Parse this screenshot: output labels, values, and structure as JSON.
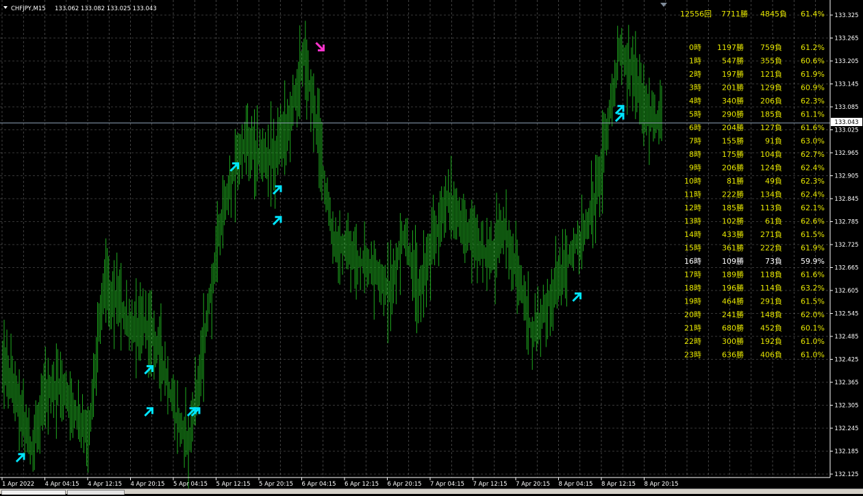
{
  "window": {
    "symbol_title": "CHFJPY,M15",
    "ohlc": "133.062 133.082 133.025 133.043"
  },
  "price_axis": {
    "labels": [
      "133.325",
      "133.265",
      "133.205",
      "133.145",
      "133.085",
      "133.025",
      "132.965",
      "132.905",
      "132.845",
      "132.785",
      "132.725",
      "132.665",
      "132.605",
      "132.545",
      "132.485",
      "132.425",
      "132.365",
      "132.305",
      "132.245",
      "132.185",
      "132.125"
    ],
    "current_price": "133.043"
  },
  "time_axis": {
    "labels": [
      "1 Apr 2022",
      "4 Apr 04:15",
      "4 Apr 12:15",
      "4 Apr 20:15",
      "5 Apr 04:15",
      "5 Apr 12:15",
      "5 Apr 20:15",
      "6 Apr 04:15",
      "6 Apr 12:15",
      "6 Apr 20:15",
      "7 Apr 04:15",
      "7 Apr 12:15",
      "7 Apr 20:15",
      "8 Apr 04:15",
      "8 Apr 12:15",
      "8 Apr 20:15"
    ]
  },
  "stats": {
    "total": {
      "count": "12556回",
      "wins": "7711勝",
      "losses": "4845負",
      "rate": "61.4%"
    },
    "hours": [
      {
        "hour": "0時",
        "wins": "1197勝",
        "losses": "759負",
        "rate": "61.2%"
      },
      {
        "hour": "1時",
        "wins": "547勝",
        "losses": "355負",
        "rate": "60.6%"
      },
      {
        "hour": "2時",
        "wins": "197勝",
        "losses": "121負",
        "rate": "61.9%"
      },
      {
        "hour": "3時",
        "wins": "201勝",
        "losses": "129負",
        "rate": "60.9%"
      },
      {
        "hour": "4時",
        "wins": "340勝",
        "losses": "206負",
        "rate": "62.3%"
      },
      {
        "hour": "5時",
        "wins": "290勝",
        "losses": "185負",
        "rate": "61.1%"
      },
      {
        "hour": "6時",
        "wins": "204勝",
        "losses": "127負",
        "rate": "61.6%"
      },
      {
        "hour": "7時",
        "wins": "155勝",
        "losses": "91負",
        "rate": "63.0%"
      },
      {
        "hour": "8時",
        "wins": "175勝",
        "losses": "104負",
        "rate": "62.7%"
      },
      {
        "hour": "9時",
        "wins": "206勝",
        "losses": "124負",
        "rate": "62.4%"
      },
      {
        "hour": "10時",
        "wins": "81勝",
        "losses": "49負",
        "rate": "62.3%"
      },
      {
        "hour": "11時",
        "wins": "222勝",
        "losses": "134負",
        "rate": "62.4%"
      },
      {
        "hour": "12時",
        "wins": "185勝",
        "losses": "113負",
        "rate": "62.1%"
      },
      {
        "hour": "13時",
        "wins": "102勝",
        "losses": "61負",
        "rate": "62.6%"
      },
      {
        "hour": "14時",
        "wins": "433勝",
        "losses": "271負",
        "rate": "61.5%"
      },
      {
        "hour": "15時",
        "wins": "361勝",
        "losses": "222負",
        "rate": "61.9%"
      },
      {
        "hour": "16時",
        "wins": "109勝",
        "losses": "73負",
        "rate": "59.9%"
      },
      {
        "hour": "17時",
        "wins": "189勝",
        "losses": "118負",
        "rate": "61.6%"
      },
      {
        "hour": "18時",
        "wins": "196勝",
        "losses": "114負",
        "rate": "63.2%"
      },
      {
        "hour": "19時",
        "wins": "464勝",
        "losses": "291負",
        "rate": "61.5%"
      },
      {
        "hour": "20時",
        "wins": "241勝",
        "losses": "148負",
        "rate": "62.0%"
      },
      {
        "hour": "21時",
        "wins": "680勝",
        "losses": "452負",
        "rate": "60.1%"
      },
      {
        "hour": "22時",
        "wins": "300勝",
        "losses": "192負",
        "rate": "61.0%"
      },
      {
        "hour": "23時",
        "wins": "636勝",
        "losses": "406負",
        "rate": "61.0%"
      }
    ],
    "highlight_hour_index": 16
  },
  "colors": {
    "background": "#000000",
    "grid": "#c8c8c8",
    "bars": "#1fae1f",
    "stats_text": "#e6e600",
    "stats_highlight": "#ffffff",
    "buy_arrow": "#00e5ff",
    "sell_arrow": "#ff33cc",
    "axis_text": "#ffffff",
    "price_line": "#8ca0b4"
  },
  "chart_data": {
    "type": "ohlc",
    "symbol": "CHFJPY",
    "timeframe": "M15",
    "ylim": [
      132.125,
      133.335
    ],
    "close_path": [
      {
        "x": "1 Apr 2022",
        "y": 132.42
      },
      {
        "x": "1 Apr 2022",
        "y": 132.33
      },
      {
        "x": "1 Apr 2022",
        "y": 132.19
      },
      {
        "x": "4 Apr 04:15",
        "y": 132.33
      },
      {
        "x": "4 Apr 04:15",
        "y": 132.36
      },
      {
        "x": "4 Apr 04:15",
        "y": 132.3
      },
      {
        "x": "4 Apr 12:15",
        "y": 132.22
      },
      {
        "x": "4 Apr 12:15",
        "y": 132.62
      },
      {
        "x": "4 Apr 12:15",
        "y": 132.58
      },
      {
        "x": "4 Apr 20:15",
        "y": 132.5
      },
      {
        "x": "4 Apr 20:15",
        "y": 132.52
      },
      {
        "x": "4 Apr 20:15",
        "y": 132.45
      },
      {
        "x": "5 Apr 04:15",
        "y": 132.28
      },
      {
        "x": "5 Apr 04:15",
        "y": 132.21
      },
      {
        "x": "5 Apr 04:15",
        "y": 132.45
      },
      {
        "x": "5 Apr 12:15",
        "y": 132.73
      },
      {
        "x": "5 Apr 12:15",
        "y": 132.9
      },
      {
        "x": "5 Apr 12:15",
        "y": 133.0
      },
      {
        "x": "5 Apr 20:15",
        "y": 132.95
      },
      {
        "x": "5 Apr 20:15",
        "y": 132.96
      },
      {
        "x": "5 Apr 20:15",
        "y": 133.05
      },
      {
        "x": "6 Apr 04:15",
        "y": 133.22
      },
      {
        "x": "6 Apr 04:15",
        "y": 133.03
      },
      {
        "x": "6 Apr 04:15",
        "y": 132.74
      },
      {
        "x": "6 Apr 12:15",
        "y": 132.7
      },
      {
        "x": "6 Apr 12:15",
        "y": 132.68
      },
      {
        "x": "6 Apr 12:15",
        "y": 132.66
      },
      {
        "x": "6 Apr 20:15",
        "y": 132.6
      },
      {
        "x": "6 Apr 20:15",
        "y": 132.75
      },
      {
        "x": "6 Apr 20:15",
        "y": 132.6
      },
      {
        "x": "7 Apr 04:15",
        "y": 132.72
      },
      {
        "x": "7 Apr 04:15",
        "y": 132.85
      },
      {
        "x": "7 Apr 04:15",
        "y": 132.78
      },
      {
        "x": "7 Apr 12:15",
        "y": 132.73
      },
      {
        "x": "7 Apr 12:15",
        "y": 132.68
      },
      {
        "x": "7 Apr 12:15",
        "y": 132.77
      },
      {
        "x": "7 Apr 20:15",
        "y": 132.63
      },
      {
        "x": "7 Apr 20:15",
        "y": 132.49
      },
      {
        "x": "7 Apr 20:15",
        "y": 132.57
      },
      {
        "x": "8 Apr 04:15",
        "y": 132.65
      },
      {
        "x": "8 Apr 04:15",
        "y": 132.72
      },
      {
        "x": "8 Apr 04:15",
        "y": 132.79
      },
      {
        "x": "8 Apr 12:15",
        "y": 132.98
      },
      {
        "x": "8 Apr 12:15",
        "y": 133.22
      },
      {
        "x": "8 Apr 12:15",
        "y": 133.18
      },
      {
        "x": "8 Apr 20:15",
        "y": 133.06
      },
      {
        "x": "8 Apr 20:15",
        "y": 133.043
      }
    ],
    "signal_arrows": [
      {
        "x": "1 Apr 2022",
        "type": "buy",
        "price": 132.17
      },
      {
        "x": "4 Apr 20:15",
        "type": "buy",
        "price": 132.4
      },
      {
        "x": "4 Apr 20:15",
        "type": "buy",
        "price": 132.29
      },
      {
        "x": "5 Apr 04:15",
        "type": "buy",
        "price": 132.29
      },
      {
        "x": "5 Apr 04:15",
        "type": "buy",
        "price": 132.29
      },
      {
        "x": "5 Apr 12:15",
        "type": "buy",
        "price": 132.93
      },
      {
        "x": "5 Apr 20:15",
        "type": "buy",
        "price": 132.87
      },
      {
        "x": "5 Apr 20:15",
        "type": "buy",
        "price": 132.79
      },
      {
        "x": "6 Apr 04:15",
        "type": "sell",
        "price": 133.24
      },
      {
        "x": "8 Apr 04:15",
        "type": "buy",
        "price": 132.59
      },
      {
        "x": "8 Apr 12:15",
        "type": "buy",
        "price": 133.08
      },
      {
        "x": "8 Apr 12:15",
        "type": "buy",
        "price": 133.06
      }
    ]
  }
}
